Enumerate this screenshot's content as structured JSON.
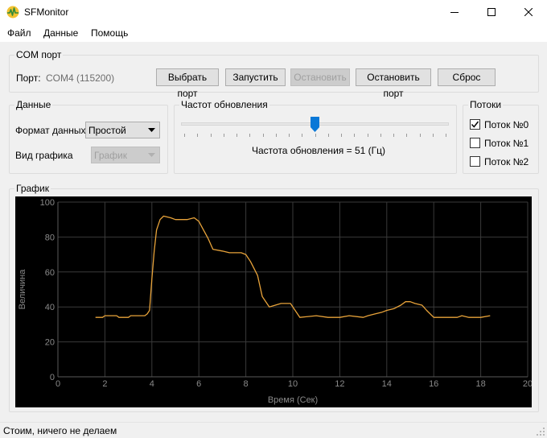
{
  "window": {
    "title": "SFMonitor",
    "icons": {
      "app": "pulse-chart-icon",
      "minimize": "minimize-icon",
      "maximize": "maximize-icon",
      "close": "close-icon"
    }
  },
  "menu": {
    "file": "Файл",
    "data": "Данные",
    "help": "Помощь"
  },
  "com_port": {
    "title": "COM порт",
    "port_label": "Порт:",
    "port_value": "COM4 (115200)",
    "select_port": "Выбрать порт",
    "start": "Запустить",
    "stop": "Остановить",
    "stop_port": "Остановить порт",
    "reset": "Сброс"
  },
  "data_panel": {
    "title": "Данные",
    "format_label": "Формат данных",
    "format_value": "Простой",
    "view_label": "Вид графика",
    "view_value": "График"
  },
  "refresh": {
    "title": "Частот обновления",
    "rate_text": "Частота обновления = 51 (Гц)",
    "slider_fraction": 0.5
  },
  "streams": {
    "title": "Потоки",
    "items": [
      {
        "label": "Поток №0",
        "checked": true
      },
      {
        "label": "Поток №1",
        "checked": false
      },
      {
        "label": "Поток №2",
        "checked": false
      }
    ]
  },
  "graph": {
    "title": "График"
  },
  "chart_data": {
    "type": "line",
    "title": "",
    "xlabel": "Время (Сек)",
    "ylabel": "Величина",
    "xlim": [
      0,
      20
    ],
    "ylim": [
      0,
      100
    ],
    "xticks": [
      0,
      2,
      4,
      6,
      8,
      10,
      12,
      14,
      16,
      18,
      20
    ],
    "yticks": [
      0,
      20,
      40,
      60,
      80,
      100
    ],
    "grid": true,
    "background": "#000000",
    "grid_color": "#3a3a3a",
    "axis_text_color": "#8a8a8a",
    "series": [
      {
        "color": "#e8a33a",
        "x": [
          1.6,
          1.9,
          2.0,
          2.5,
          2.6,
          3.0,
          3.1,
          3.7,
          3.8,
          3.9,
          4.0,
          4.1,
          4.2,
          4.35,
          4.5,
          4.8,
          5.0,
          5.5,
          5.8,
          6.0,
          6.2,
          6.4,
          6.6,
          7.0,
          7.3,
          7.8,
          8.0,
          8.2,
          8.5,
          8.7,
          9.0,
          9.5,
          9.9,
          10.1,
          10.3,
          11.0,
          11.5,
          12.0,
          12.4,
          13.0,
          13.2,
          13.5,
          13.8,
          14.0,
          14.3,
          14.6,
          14.8,
          15.0,
          15.2,
          15.5,
          15.7,
          16.0,
          17.0,
          17.2,
          17.5,
          18.0,
          18.4
        ],
        "y": [
          34,
          34,
          35,
          35,
          34,
          34,
          35,
          35,
          36,
          38,
          56,
          72,
          84,
          90,
          92,
          91,
          90,
          90,
          91,
          89,
          84,
          79,
          73,
          72,
          71,
          71,
          70,
          66,
          58,
          46,
          40,
          42,
          42,
          38,
          34,
          35,
          34,
          34,
          35,
          34,
          35,
          36,
          37,
          38,
          39,
          41,
          43,
          43,
          42,
          41,
          38,
          34,
          34,
          35,
          34,
          34,
          35
        ]
      }
    ]
  },
  "status": {
    "text": "Стоим, ничего не делаем"
  }
}
